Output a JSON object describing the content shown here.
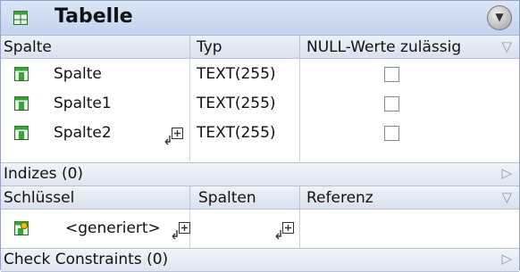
{
  "title": "Tabelle",
  "columns_header": {
    "col1": "Spalte",
    "col2": "Typ",
    "col3": "NULL-Werte zulässig"
  },
  "columns": [
    {
      "name": "Spalte",
      "type": "TEXT(255)",
      "nullable": false
    },
    {
      "name": "Spalte1",
      "type": "TEXT(255)",
      "nullable": false
    },
    {
      "name": "Spalte2",
      "type": "TEXT(255)",
      "nullable": false
    }
  ],
  "indices": {
    "label": "Indizes (0)"
  },
  "keys_header": {
    "col1": "Schlüssel",
    "col2": "Spalten",
    "col3": "Referenz"
  },
  "keys": [
    {
      "name": "<generiert>"
    }
  ],
  "check_constraints": {
    "label": "Check Constraints (0)"
  },
  "colors": {
    "title_bg": "#c3d3ec",
    "border": "#8ea4c8",
    "icon_green": "#3aa13a"
  }
}
